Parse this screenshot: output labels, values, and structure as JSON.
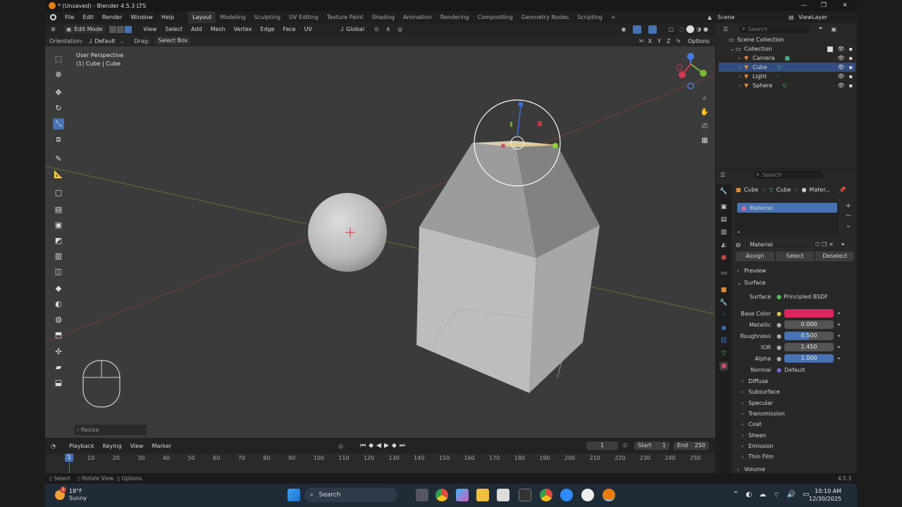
{
  "window": {
    "title": "* (Unsaved) - Blender 4.5.3 LTS",
    "min": "—",
    "max": "❐",
    "close": "✕"
  },
  "menu": [
    "File",
    "Edit",
    "Render",
    "Window",
    "Help"
  ],
  "workspaces": [
    "Layout",
    "Modeling",
    "Sculpting",
    "UV Editing",
    "Texture Paint",
    "Shading",
    "Animation",
    "Rendering",
    "Compositing",
    "Geometry Nodes",
    "Scripting"
  ],
  "add_workspace": "+",
  "scene": {
    "label": "Scene",
    "viewlayer": "ViewLayer"
  },
  "viewport_header": {
    "mode": "Edit Mode",
    "menus": [
      "View",
      "Select",
      "Add",
      "Mesh",
      "Vertex",
      "Edge",
      "Face",
      "UV"
    ],
    "transform": "Global"
  },
  "viewport_header2": {
    "orientation_label": "Orientation:",
    "orientation_value": "Default",
    "drag_label": "Drag:",
    "drag_value": "Select Box",
    "axes": [
      "X",
      "Y",
      "Z"
    ],
    "options": "Options"
  },
  "viewport": {
    "perspective": "User Perspective",
    "object": "(1) Cube | Cube",
    "last_op": "Resize"
  },
  "outliner": {
    "search_placeholder": "Search",
    "root": "Scene Collection",
    "collection": "Collection",
    "items": [
      "Camera",
      "Cube",
      "Light",
      "Sphere"
    ],
    "selected": "Cube"
  },
  "properties": {
    "search_placeholder": "Search",
    "breadcrumb": [
      "Cube",
      "Cube",
      "Mater..."
    ],
    "slot": "Material",
    "material_name": "Material",
    "buttons": [
      "Assign",
      "Select",
      "Deselect"
    ],
    "sections_top": [
      "Preview",
      "Surface"
    ],
    "surface_label": "Surface",
    "surface_value": "Principled BSDF",
    "fields": [
      {
        "label": "Base Color",
        "value": ""
      },
      {
        "label": "Metallic",
        "value": "0.000"
      },
      {
        "label": "Roughness",
        "value": "0.500"
      },
      {
        "label": "IOR",
        "value": "1.450"
      },
      {
        "label": "Alpha",
        "value": "1.000"
      },
      {
        "label": "Normal",
        "value": "Default"
      }
    ],
    "subsections": [
      "Diffuse",
      "Subsurface",
      "Specular",
      "Transmission",
      "Coat",
      "Sheen",
      "Emission",
      "Thin Film",
      "Volume"
    ],
    "base_color": "#e0245e"
  },
  "timeline": {
    "menus": [
      "Playback",
      "Keying",
      "View",
      "Marker"
    ],
    "current": "1",
    "start_label": "Start",
    "start": "1",
    "end_label": "End",
    "end": "250",
    "ticks": [
      "1",
      "10",
      "20",
      "30",
      "40",
      "50",
      "60",
      "70",
      "80",
      "90",
      "100",
      "110",
      "120",
      "130",
      "140",
      "150",
      "160",
      "170",
      "180",
      "190",
      "200",
      "210",
      "220",
      "230",
      "240",
      "250"
    ]
  },
  "status": {
    "items": [
      "Select",
      "Rotate View",
      "Options"
    ],
    "version": "4.5.3"
  },
  "taskbar": {
    "weather_temp": "18°F",
    "weather_desc": "Sunny",
    "search": "Search",
    "time": "10:10 AM",
    "date": "12/30/2025",
    "badge": "3"
  },
  "colors": {
    "accent": "#4772b3",
    "selected_row": "#334d80",
    "viewport_bg": "#3b3b3b"
  }
}
